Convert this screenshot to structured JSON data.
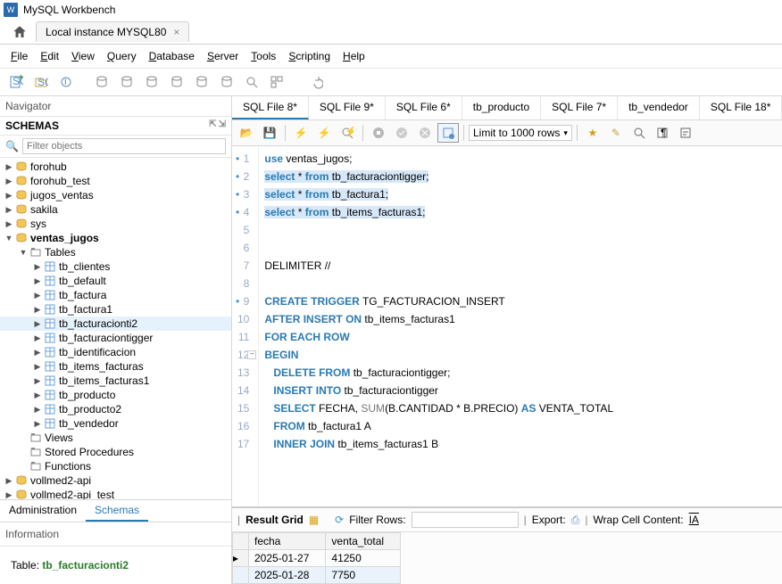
{
  "app": {
    "title": "MySQL Workbench"
  },
  "connection": {
    "tab_label": "Local instance MYSQL80"
  },
  "menus": [
    "File",
    "Edit",
    "View",
    "Query",
    "Database",
    "Server",
    "Tools",
    "Scripting",
    "Help"
  ],
  "navigator": {
    "title": "Navigator",
    "schemas_header": "SCHEMAS",
    "filter_placeholder": "Filter objects"
  },
  "schemas": {
    "top": [
      "forohub",
      "forohub_test",
      "jugos_ventas",
      "sakila",
      "sys"
    ],
    "open_db": "ventas_jugos",
    "tables_label": "Tables",
    "tables": [
      "tb_clientes",
      "tb_default",
      "tb_factura",
      "tb_factura1",
      "tb_facturacionti2",
      "tb_facturaciontigger",
      "tb_identificacion",
      "tb_items_facturas",
      "tb_items_facturas1",
      "tb_producto",
      "tb_producto2",
      "tb_vendedor"
    ],
    "selected_table": "tb_facturacionti2",
    "views_label": "Views",
    "sp_label": "Stored Procedures",
    "fn_label": "Functions",
    "bottom": [
      "vollmed2-api",
      "vollmed2-api_test"
    ]
  },
  "admin_tabs": {
    "left": "Administration",
    "right": "Schemas"
  },
  "info": {
    "header": "Information",
    "label": "Table:",
    "value": "tb_facturacionti2"
  },
  "sql_tabs": [
    "SQL File 8*",
    "SQL File 9*",
    "SQL File 6*",
    "tb_producto",
    "SQL File 7*",
    "tb_vendedor",
    "SQL File 18*"
  ],
  "limit_label": "Limit to 1000 rows",
  "code_lines": [
    {
      "n": 1,
      "dot": true,
      "html": "<span class='kw'>use</span> ventas_jugos;"
    },
    {
      "n": 2,
      "dot": true,
      "hl": true,
      "html": "<span class='kw'>select</span> * <span class='kw'>from</span> tb_facturaciontigger;"
    },
    {
      "n": 3,
      "dot": true,
      "hl": true,
      "html": "<span class='kw'>select</span> * <span class='kw'>from</span> tb_factura1;"
    },
    {
      "n": 4,
      "dot": true,
      "hl": true,
      "html": "<span class='kw'>select</span> * <span class='kw'>from</span> tb_items_facturas1;"
    },
    {
      "n": 5,
      "html": ""
    },
    {
      "n": 6,
      "html": ""
    },
    {
      "n": 7,
      "html": "DELIMITER //"
    },
    {
      "n": 8,
      "html": ""
    },
    {
      "n": 9,
      "dot": true,
      "html": "<span class='kw'>CREATE</span> <span class='kw'>TRIGGER</span> TG_FACTURACION_INSERT"
    },
    {
      "n": 10,
      "html": "<span class='kw'>AFTER</span> <span class='kw'>INSERT</span> <span class='kw'>ON</span> tb_items_facturas1"
    },
    {
      "n": 11,
      "html": "<span class='kw'>FOR EACH</span> <span class='kw'>ROW</span>"
    },
    {
      "n": 12,
      "fold": true,
      "html": "<span class='kw'>BEGIN</span>"
    },
    {
      "n": 13,
      "html": "   <span class='kw'>DELETE</span> <span class='kw'>FROM</span> tb_facturaciontigger;"
    },
    {
      "n": 14,
      "html": "   <span class='kw'>INSERT</span> <span class='kw'>INTO</span> tb_facturaciontigger"
    },
    {
      "n": 15,
      "html": "   <span class='kw'>SELECT</span> FECHA, <span class='fn'>SUM</span>(B.CANTIDAD * B.PRECIO) <span class='kw'>AS</span> VENTA_TOTAL"
    },
    {
      "n": 16,
      "html": "   <span class='kw'>FROM</span> tb_factura1 A"
    },
    {
      "n": 17,
      "html": "   <span class='kw'>INNER</span> <span class='kw'>JOIN</span> tb_items_facturas1 B"
    }
  ],
  "results": {
    "toolbar": {
      "grid_label": "Result Grid",
      "filter_label": "Filter Rows:",
      "export_label": "Export:",
      "wrap_label": "Wrap Cell Content:"
    },
    "columns": [
      "fecha",
      "venta_total"
    ],
    "rows": [
      {
        "fecha": "2025-01-27",
        "venta_total": "41250"
      },
      {
        "fecha": "2025-01-28",
        "venta_total": "7750"
      }
    ]
  }
}
